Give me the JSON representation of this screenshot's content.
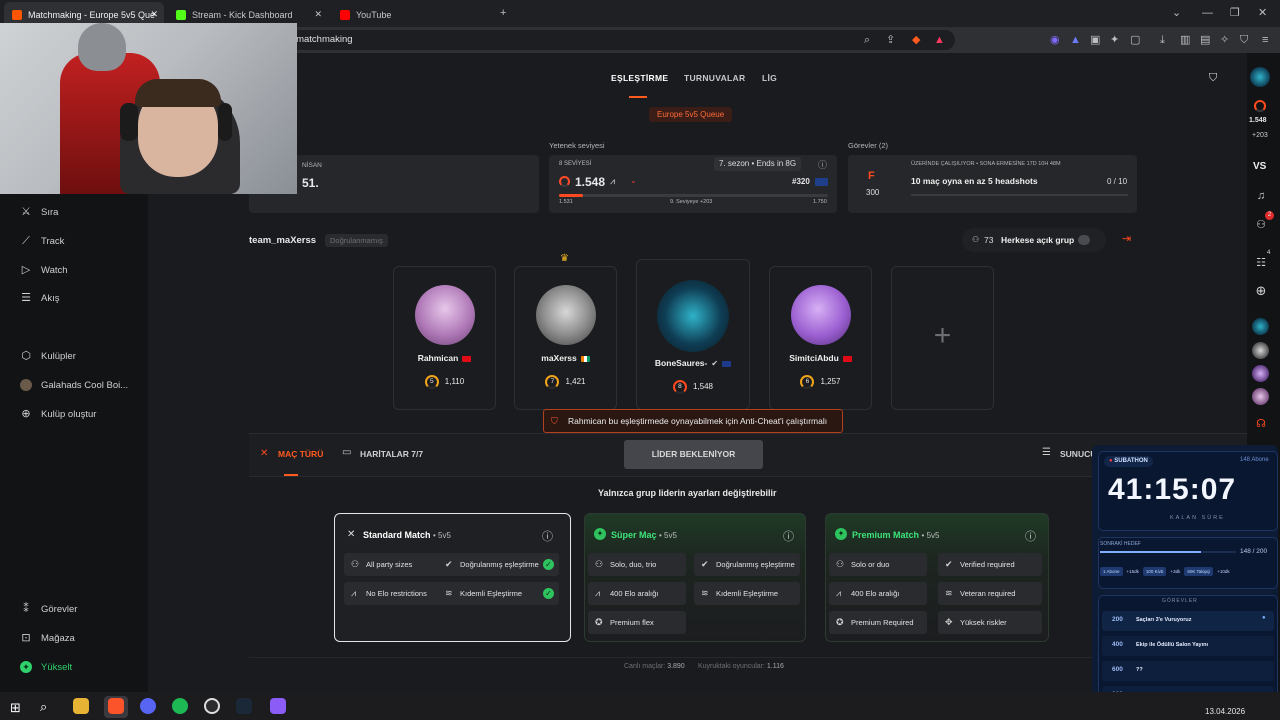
{
  "browser": {
    "tabs": [
      {
        "label": "Matchmaking - Europe 5v5 Que",
        "active": true
      },
      {
        "label": "Stream - Kick Dashboard",
        "active": false
      },
      {
        "label": "YouTube",
        "active": false
      }
    ],
    "url": "/tr/matchmaking"
  },
  "leftnav": {
    "items_top": [
      {
        "label": "Sıra",
        "icon": "swords-icon"
      },
      {
        "label": "Track",
        "icon": "chart-icon"
      },
      {
        "label": "Watch",
        "icon": "play-icon"
      },
      {
        "label": "Akış",
        "icon": "feed-icon"
      }
    ],
    "items_clubs": [
      {
        "label": "Kulüpler",
        "icon": "clubs-icon"
      },
      {
        "label": "Galahads Cool Boi...",
        "icon": "club-avatar"
      },
      {
        "label": "Kulüp oluştur",
        "icon": "plus-circle-icon"
      }
    ],
    "items_bottom": [
      {
        "label": "Görevler",
        "icon": "missions-icon"
      },
      {
        "label": "Mağaza",
        "icon": "shop-icon"
      },
      {
        "label": "Yükselt",
        "icon": "upgrade-icon"
      }
    ]
  },
  "topnav": {
    "tabs": [
      "EŞLEŞTİRME",
      "TURNUVALAR",
      "LİG"
    ],
    "active": "EŞLEŞTİRME"
  },
  "queue_badge": "Europe 5v5 Queue",
  "nisan": {
    "label": "NİSAN",
    "value": "51."
  },
  "skill": {
    "section_label": "Yetenek seviyesi",
    "level_label": "8 SEVİYESİ",
    "elo": "1.548",
    "season": "7. sezon • Ends in 8G",
    "rank": "#320",
    "range_min": "1.531",
    "range_mid": "9. Seviyeye +203",
    "range_max": "1.750",
    "progress": 0.09
  },
  "missions": {
    "section_label": "Görevler (2)",
    "top_text": "ÜZERİNDE ÇALIŞILIYOR • SONA ERMESİNE 17D 10H 48M",
    "task": "10 maç oyna en az 5 headshots",
    "progress_text": "0 / 10",
    "points": "300",
    "grade": "F"
  },
  "party": {
    "team_name": "team_maXerss",
    "verify_tag": "Doğrulanmamış",
    "count": "73",
    "visibility": "Herkese açık grup"
  },
  "players": [
    {
      "name": "Rahmican",
      "level": "5",
      "elo": "1,110",
      "flag": "#e30a17"
    },
    {
      "name": "maXerss",
      "level": "7",
      "elo": "1,421",
      "flag": "#f77f00"
    },
    {
      "name": "BoneSaures-",
      "level": "8",
      "elo": "1,548",
      "flag": "#1e3a8a"
    },
    {
      "name": "SimitciAbdu",
      "level": "6",
      "elo": "1,257",
      "flag": "#e30a17"
    }
  ],
  "warning": "Rahmican bu eşleştirmede oynayabilmek için Anti-Cheat'i çalıştırmalı",
  "match_tabs": {
    "mac_turu": "MAÇ TÜRÜ",
    "haritalar": "HARİTALAR 7/7",
    "sunucu": "SUNUCU"
  },
  "leader_button": "LİDER BEKLENİYOR",
  "leader_note": "Yalnızca grup liderin ayarları değiştirebilir",
  "modes": [
    {
      "title": "Standard Match",
      "suffix": "• 5v5",
      "chips": [
        "All party sizes",
        "Doğrulanmış eşleştirme",
        "No Elo restrictions",
        "Kıdemli Eşleştirme"
      ]
    },
    {
      "title": "Süper Maç",
      "suffix": "• 5v5",
      "chips": [
        "Solo, duo, trio",
        "Doğrulanmış eşleştirme",
        "400 Elo aralığı",
        "Kıdemli Eşleştirme",
        "Premium flex"
      ]
    },
    {
      "title": "Premium Match",
      "suffix": "• 5v5",
      "chips": [
        "Solo or duo",
        "Verified required",
        "400 Elo aralığı",
        "Veteran required",
        "Premium Required",
        "Yüksek riskler"
      ]
    }
  ],
  "footer": {
    "live_label": "Canlı maçlar:",
    "live_value": "3.890",
    "queue_label": "Kuyruktaki oyuncular:",
    "queue_value": "1.116"
  },
  "rail": {
    "elo": "1.548",
    "delta": "+203",
    "vs": "VS",
    "notif_count": "2",
    "party_count": "4"
  },
  "subathon": {
    "badge": "SUBATHON",
    "subtitle": "148 Abone",
    "timer": "41:15:07",
    "timer_label": "KALAN SÜRE",
    "next_label": "SONRAKİ HEDEF",
    "next_value": "148 / 200",
    "next_progress": 0.74,
    "chips": [
      "1 Abone",
      "+15dk",
      "100 Kivb",
      "+3dk",
      "60K Takipçi",
      "+10dk"
    ],
    "goals_label": "GÖREVLER",
    "goals": [
      {
        "num": "200",
        "text": "Saçları 3'e Vuruyoruz"
      },
      {
        "num": "400",
        "text": "Ekip ile Ödüllü Salon Yayını"
      },
      {
        "num": "600",
        "text": "??"
      },
      {
        "num": "800",
        "text": "???"
      }
    ]
  },
  "taskbar": {
    "date": "13.04.2026"
  }
}
